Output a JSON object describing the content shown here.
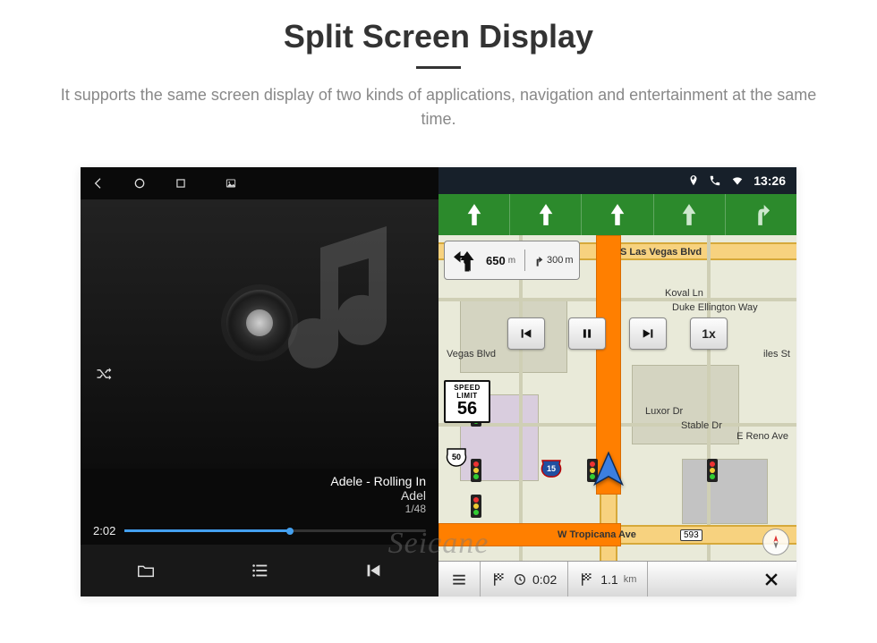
{
  "header": {
    "title": "Split Screen Display",
    "subtitle": "It supports the same screen display of two kinds of applications, navigation and entertainment at the same time."
  },
  "music": {
    "track_line1": "Adele - Rolling In",
    "track_line2": "Adel",
    "track_index": "1/48",
    "elapsed": "2:02"
  },
  "nav": {
    "clock": "13:26",
    "main_distance": "650",
    "main_unit": "m",
    "next_distance": "300",
    "next_unit": "m",
    "speed_label1": "SPEED",
    "speed_label2": "LIMIT",
    "speed_limit": "56",
    "playback_speed": "1x",
    "route_shield": "50",
    "interstate": "15",
    "bottom_time": "0:02",
    "bottom_dist": "1.1",
    "bottom_dist_unit": "km",
    "streets": {
      "s_vegas": "S Las Vegas Blvd",
      "koval": "Koval Ln",
      "d_elling": "Duke Ellington Way",
      "luxor": "Luxor Dr",
      "stable": "Stable Dr",
      "e_reno": "E Reno Ave",
      "vegas2": "Vegas Blvd",
      "tropicana": "W Tropicana Ave",
      "giles": "iles St"
    },
    "exit": "593"
  },
  "watermark": "Seicane"
}
